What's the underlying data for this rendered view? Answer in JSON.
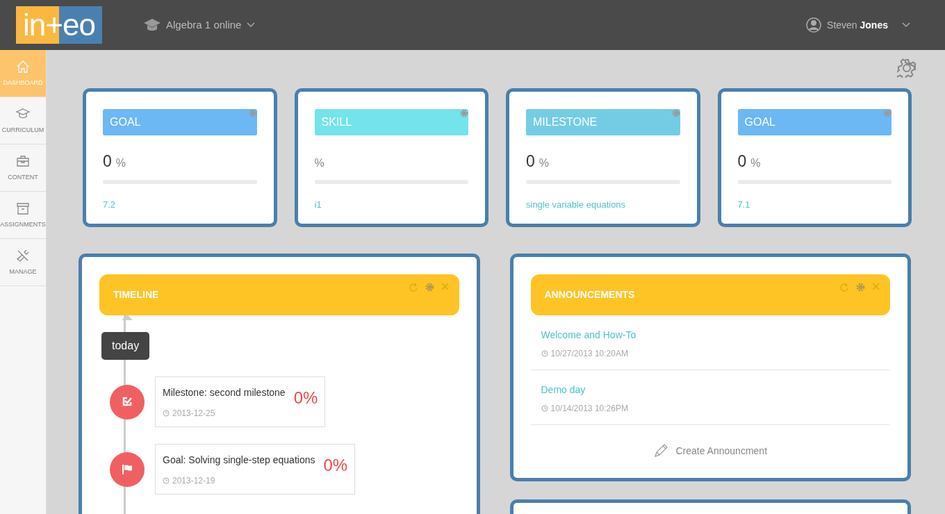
{
  "topbar": {
    "logo": "in+eo",
    "course": "Algebra 1 online",
    "user_first": "Steven",
    "user_last": "Jones"
  },
  "sidebar": {
    "items": [
      {
        "label": "DASHBOARD",
        "kind": "home",
        "selected": true
      },
      {
        "label": "CURRICULUM",
        "kind": "cap",
        "selected": false
      },
      {
        "label": "CONTENT",
        "kind": "case",
        "selected": false
      },
      {
        "label": "ASSIGNMENTS",
        "kind": "box",
        "selected": false
      },
      {
        "label": "MANAGE",
        "kind": "tools",
        "selected": false
      }
    ]
  },
  "stat_cards": [
    {
      "title": "GOAL",
      "color": "#6cb8f4",
      "value": "0",
      "unit": "%",
      "level": 0,
      "link": "7.2"
    },
    {
      "title": "SKILL",
      "color": "#74e3ec",
      "unit": "%",
      "level": 0,
      "link": "i1"
    },
    {
      "title": "MILESTONE",
      "color": "#74cce4",
      "value": "0",
      "unit": "%",
      "level": 0,
      "link": "single variable equations"
    },
    {
      "title": "GOAL",
      "color": "#6cb8f4",
      "value": "0",
      "unit": "%",
      "level": 0,
      "link": "7.1"
    }
  ],
  "timeline": {
    "title": "TIMELINE",
    "today": "today",
    "items": [
      {
        "kind": "milestone",
        "title": "Milestone: second milestone",
        "percent": "0%",
        "date": "2013-12-25"
      },
      {
        "kind": "goal",
        "title": "Goal: Solving single-step equations",
        "percent": "0%",
        "date": "2013-12-19"
      }
    ]
  },
  "announcements": {
    "title": "ANNOUNCEMENTS",
    "items": [
      {
        "title": "Welcome and How-To",
        "date": "10/27/2013 10:20AM"
      },
      {
        "title": "Demo day",
        "date": "10/14/2013 10:26PM"
      }
    ],
    "create": "Create Announcment"
  }
}
